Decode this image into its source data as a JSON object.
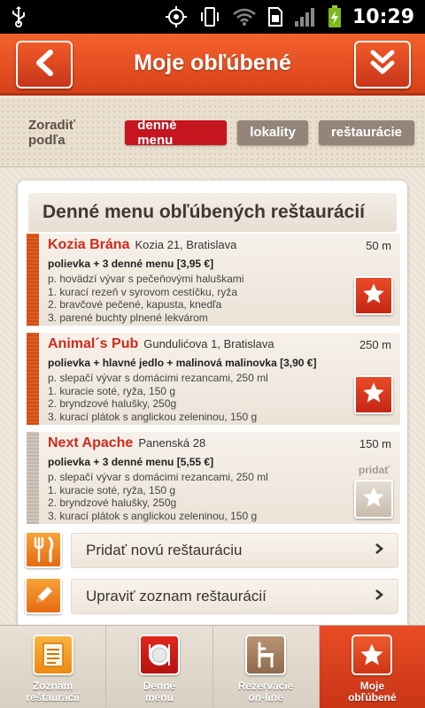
{
  "status_bar": {
    "time": "10:29"
  },
  "header": {
    "title": "Moje obľúbené"
  },
  "sort": {
    "label": "Zoradiť podľa",
    "options": [
      {
        "label": "denné menu",
        "active": true
      },
      {
        "label": "lokality",
        "active": false
      },
      {
        "label": "reštaurácie",
        "active": false
      }
    ]
  },
  "card": {
    "title": "Denné menu obľúbených reštaurácií",
    "restaurants": [
      {
        "name": "Kozia Brána",
        "address": "Kozia 21, Bratislava",
        "distance": "50 m",
        "headline": "polievka + 3 denné menu [3,95 €]",
        "lines": [
          "p.  hovädzí vývar s pečeňovými haluškami",
          "1.  kurací rezeň v syrovom cestíčku, ryža",
          "2.  bravčové pečené, kapusta, knedľa",
          "3.  parené buchty plnené lekvárom"
        ],
        "favorite": true
      },
      {
        "name": "Animal´s Pub",
        "address": "Gundulićova 1, Bratislava",
        "distance": "250 m",
        "headline": "polievka + hlavné jedlo + malinová malinovka [3,90 €]",
        "lines": [
          "p. slepačí vývar s domácimi rezancami,  250 ml",
          "1. kuracie soté, ryža, 150 g",
          "2. bryndzové halušky, 250g",
          "3. kurací plátok s anglickou zeleninou, 150 g"
        ],
        "favorite": true
      },
      {
        "name": "Next Apache",
        "address": "Panenská 28",
        "distance": "150 m",
        "headline": "polievka + 3 denné menu [5,55 €]",
        "lines": [
          "p. slepačí vývar s domácimi rezancami,  250 ml",
          "1. kuracie soté, ryža, 150 g",
          "2. bryndzové halušky, 250g",
          "3. kurací plátok s anglickou zeleninou, 150 g"
        ],
        "favorite": false,
        "add_label": "pridať"
      }
    ],
    "actions": [
      {
        "label": "Pridať novú reštauráciu",
        "icon": "fork-knife-icon"
      },
      {
        "label": "Upraviť zoznam reštaurácií",
        "icon": "pencil-icon"
      }
    ]
  },
  "tabs": [
    {
      "line1": "Zoznam",
      "line2": "reštaurácií",
      "icon": "list-icon",
      "active": false
    },
    {
      "line1": "Denné",
      "line2": "menu",
      "icon": "plate-icon",
      "active": false
    },
    {
      "line1": "Rezervácie",
      "line2": "on-line",
      "icon": "chair-icon",
      "active": false
    },
    {
      "line1": "Moje",
      "line2": "obľúbené",
      "icon": "star-icon",
      "active": true
    }
  ],
  "colors": {
    "accent": "#e84c25",
    "sort_active": "#c5151f",
    "sort_inactive": "#93857a",
    "restaurant_name": "#cf2a1a"
  }
}
